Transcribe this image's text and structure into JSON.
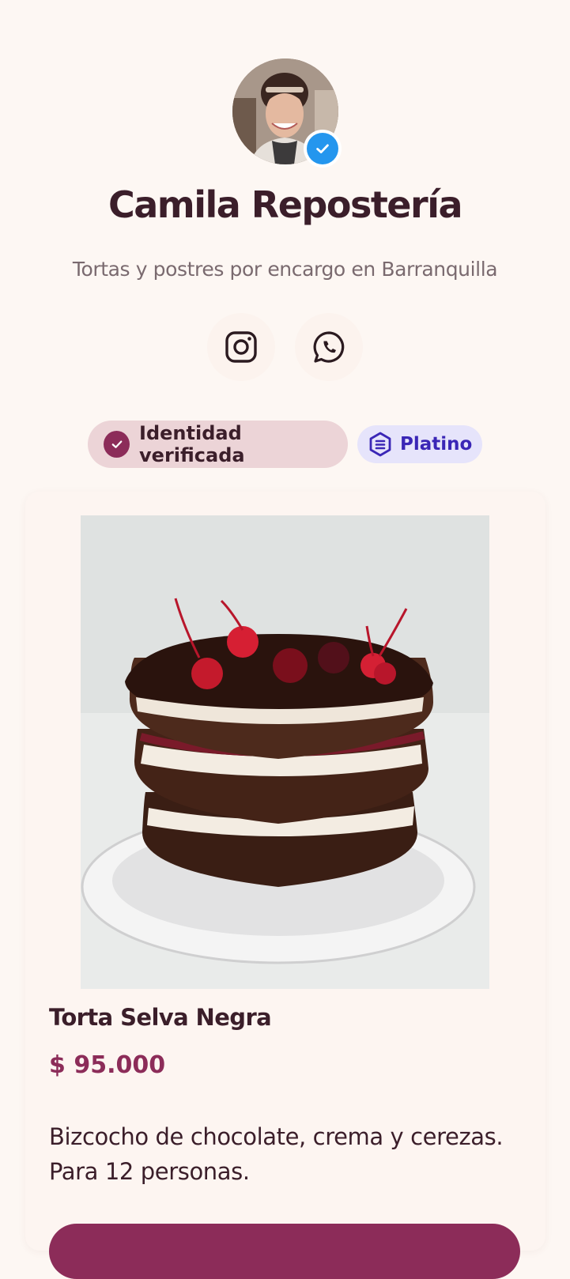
{
  "profile": {
    "name": "Camila Repostería",
    "tagline": "Tortas y postres por encargo en Barranquilla",
    "avatar_icon": "avatar-photo",
    "verified_icon": "verified-check-icon"
  },
  "social": {
    "instagram_icon": "instagram-icon",
    "whatsapp_icon": "whatsapp-icon"
  },
  "badges": {
    "identity_label": "Identidad verificada",
    "tier_label": "Platino"
  },
  "product": {
    "title": "Torta Selva Negra",
    "price": "$ 95.000",
    "description": "Bizcocho de chocolate, crema y cerezas. Para 12 personas."
  },
  "colors": {
    "background": "#fdf7f3",
    "accent": "#8c2c59",
    "verified_blue": "#2496ee",
    "tier_text": "#3a26b6",
    "tier_bg": "#e6e4fb",
    "identity_bg": "#ecd4d7"
  }
}
